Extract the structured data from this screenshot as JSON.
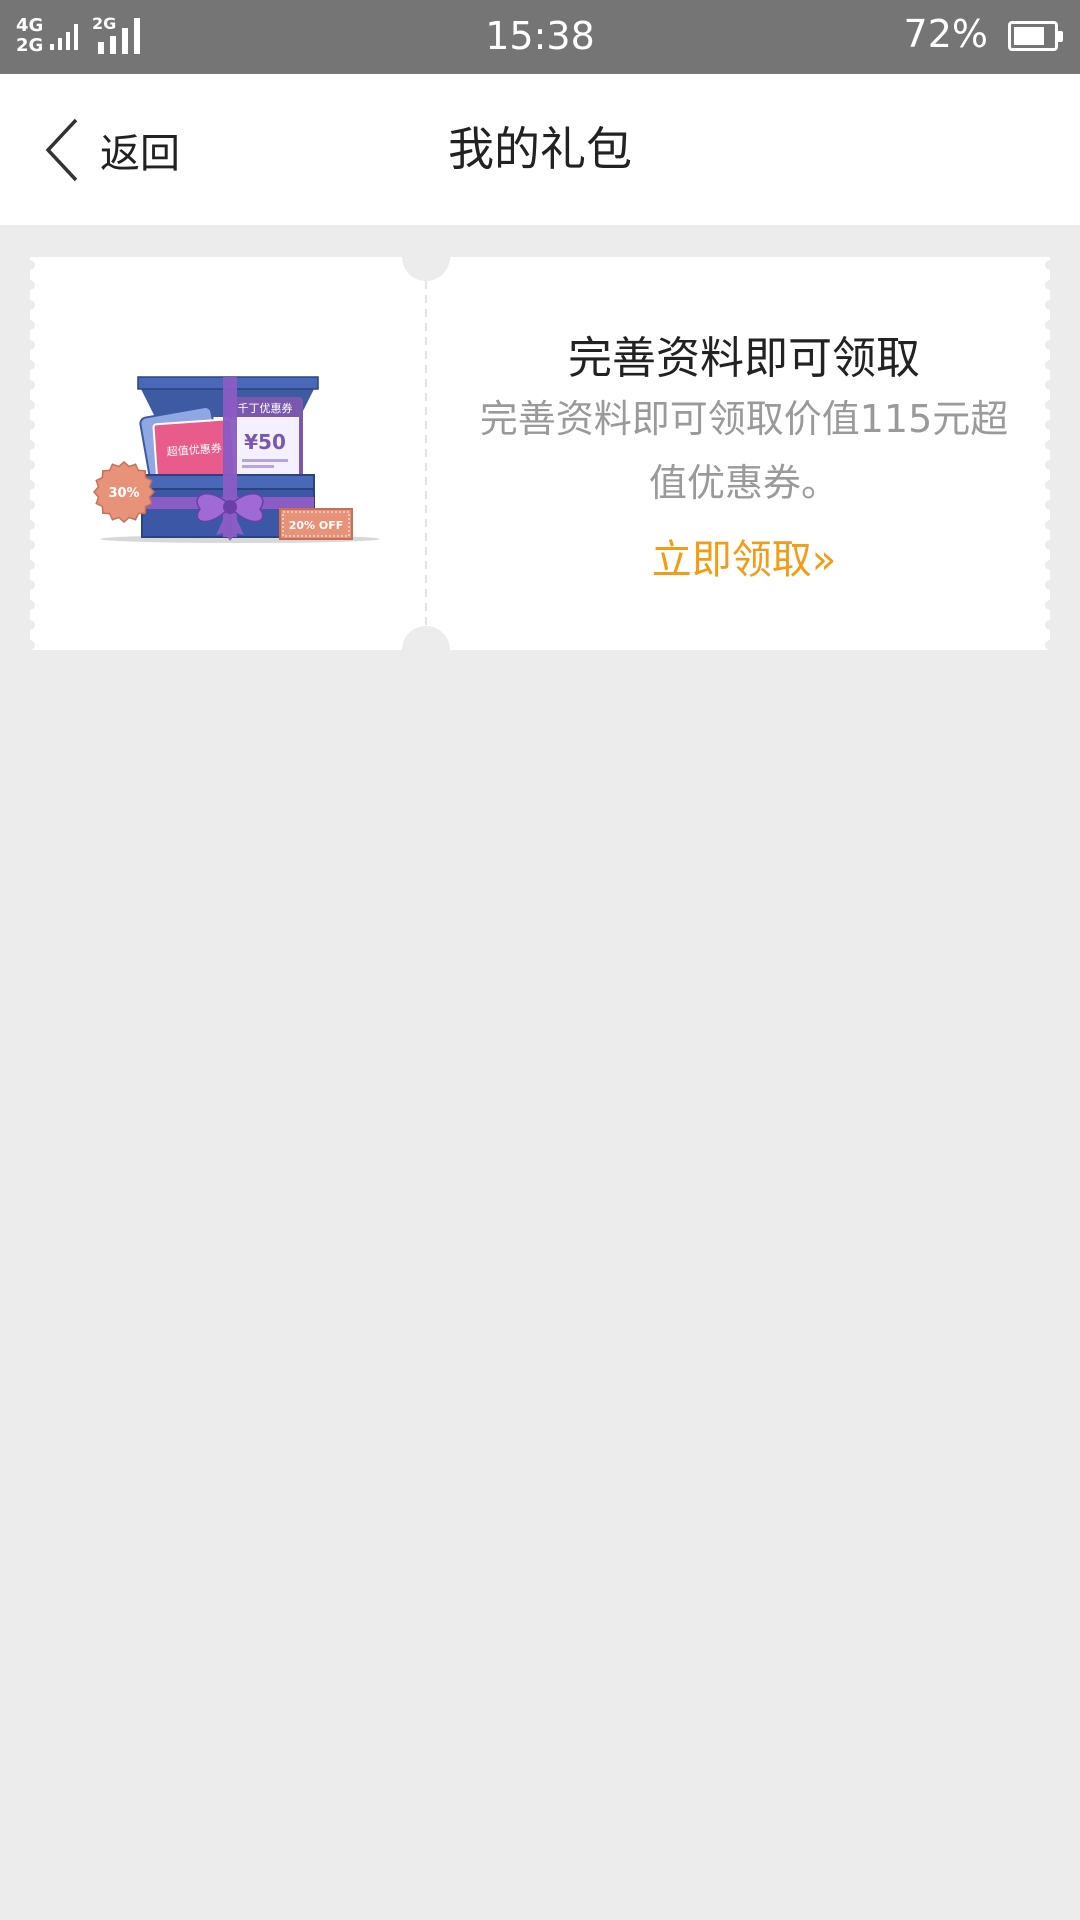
{
  "status_bar": {
    "network_top": "4G",
    "network_bottom": "2G",
    "network_second": "2G",
    "time": "15:38",
    "battery_percent": "72%",
    "battery_level": 0.72
  },
  "nav": {
    "back_label": "返回",
    "title": "我的礼包"
  },
  "gift_card": {
    "title": "完善资料即可领取",
    "description": "完善资料即可领取价值115元超值优惠券。",
    "action_label": "立即领取»",
    "illustration": {
      "coupon_purple_label": "千丁优惠券",
      "coupon_amount": "¥50",
      "coupon_pink_label": "超值优惠券",
      "badge_round": "30%",
      "tag_label": "20% OFF"
    }
  },
  "colors": {
    "status_bar": "#757575",
    "page_bg": "#ececec",
    "accent": "#f59b14",
    "muted_text": "#9a9a9a"
  }
}
